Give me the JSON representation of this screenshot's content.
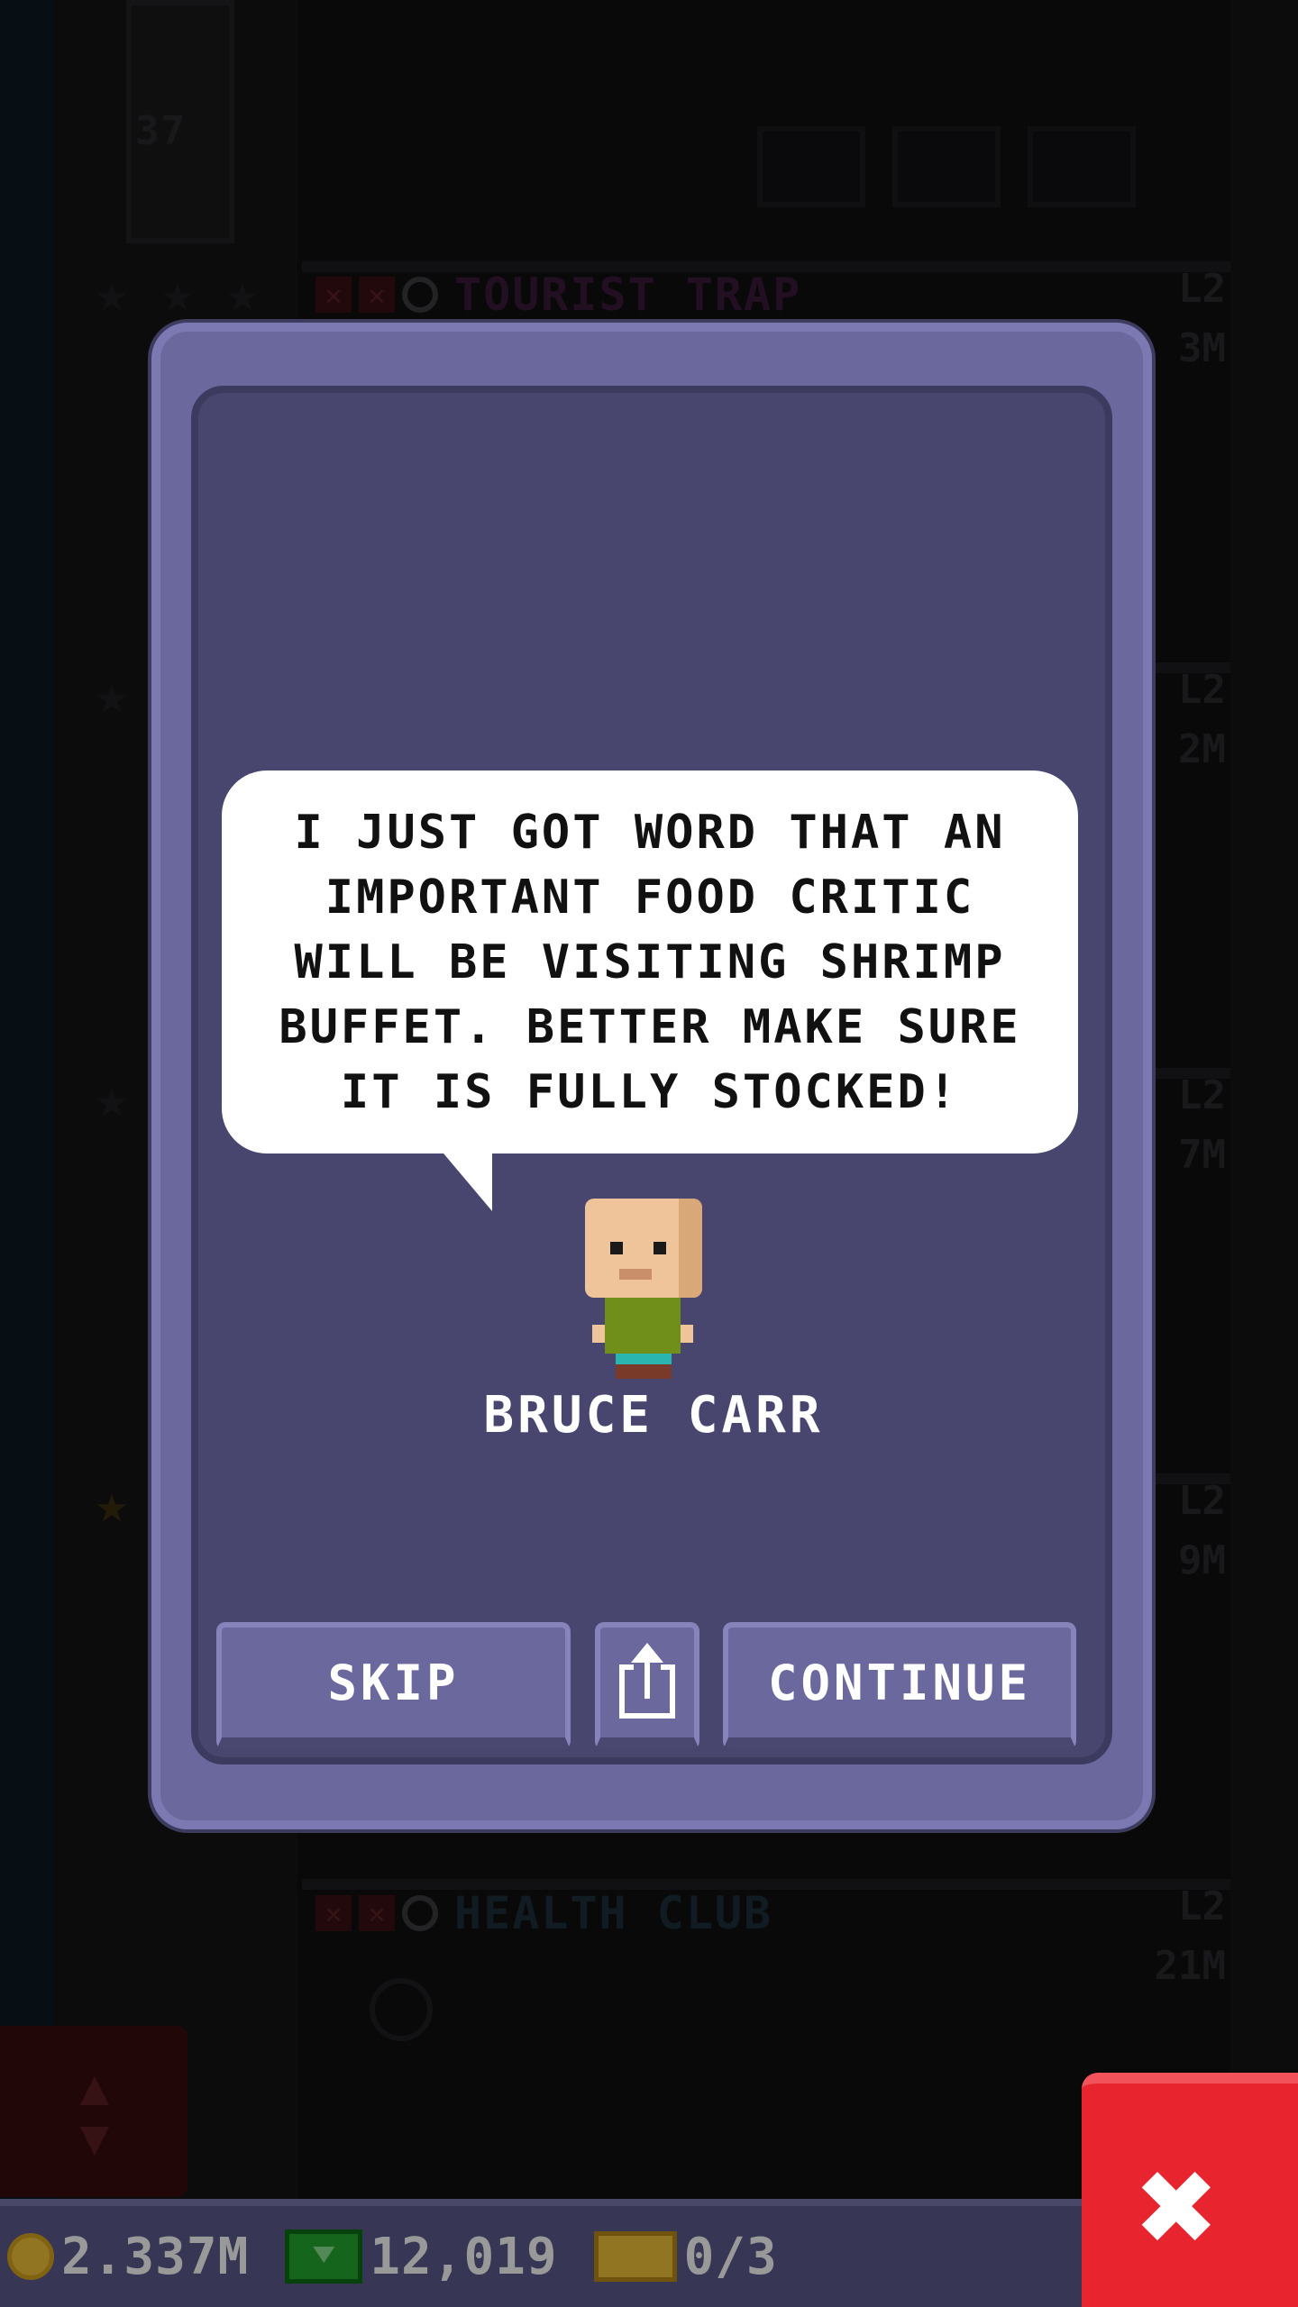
{
  "background": {
    "floor_number": "37",
    "floors": [
      {
        "name": "TOURIST TRAP",
        "level": "L2",
        "value": "3M",
        "name_color": "#3a1a3a"
      },
      {
        "name": "",
        "level": "L2",
        "value": "2M",
        "name_color": ""
      },
      {
        "name": "",
        "level": "L2",
        "value": "7M",
        "name_color": ""
      },
      {
        "name": "",
        "level": "L2",
        "value": "9M",
        "name_color": ""
      },
      {
        "name": "HEALTH CLUB",
        "level": "L2",
        "value": "21M",
        "name_color": "#1c2e3a"
      }
    ]
  },
  "dialog": {
    "message": "I JUST GOT WORD THAT AN IMPORTANT FOOD CRITIC WILL BE VISITING SHRIMP BUFFET. BETTER MAKE SURE IT IS FULLY STOCKED!",
    "character_name": "BRUCE CARR",
    "skip_label": "SKIP",
    "continue_label": "CONTINUE",
    "share_icon": "share-icon"
  },
  "hud": {
    "coins": "2.337M",
    "bux": "12,019",
    "tickets": "0/3",
    "close_icon": "close-icon"
  },
  "colors": {
    "dialog_outer": "#6b689e",
    "dialog_inner": "#48456f",
    "hud_bar": "#5d5a8c",
    "close_red": "#e8252f"
  }
}
